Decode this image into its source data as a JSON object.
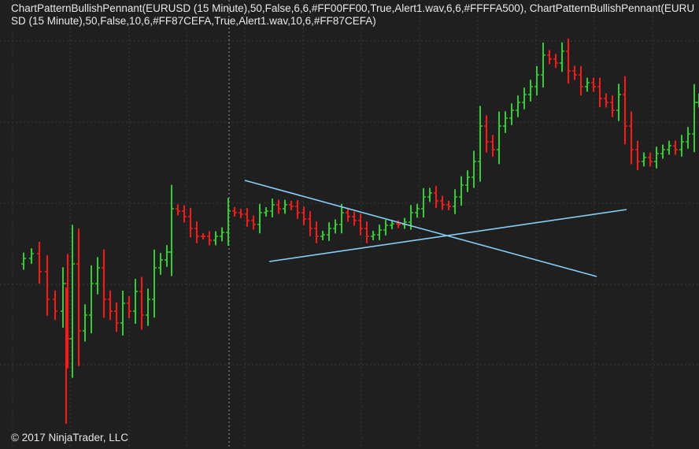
{
  "chart": {
    "indicator_label": "ChartPatternBullishPennant(EURUSD (15 Minute),50,False,6,6,#FF00FF00,True,Alert1.wav,6,6,#FFFFA500), ChartPatternBullishPennant(EURUSD (15 Minute),50,False,10,6,#FF87CEFA,True,Alert1.wav,10,6,#FF87CEFA)",
    "copyright": "© 2017 NinjaTrader, LLC",
    "colors": {
      "background": "#1f1f1f",
      "grid": "#3a3a3a",
      "up_bar": "#32cd32",
      "down_bar": "#ff1a1a",
      "pennant_line": "#87cefa"
    },
    "icons": []
  }
}
